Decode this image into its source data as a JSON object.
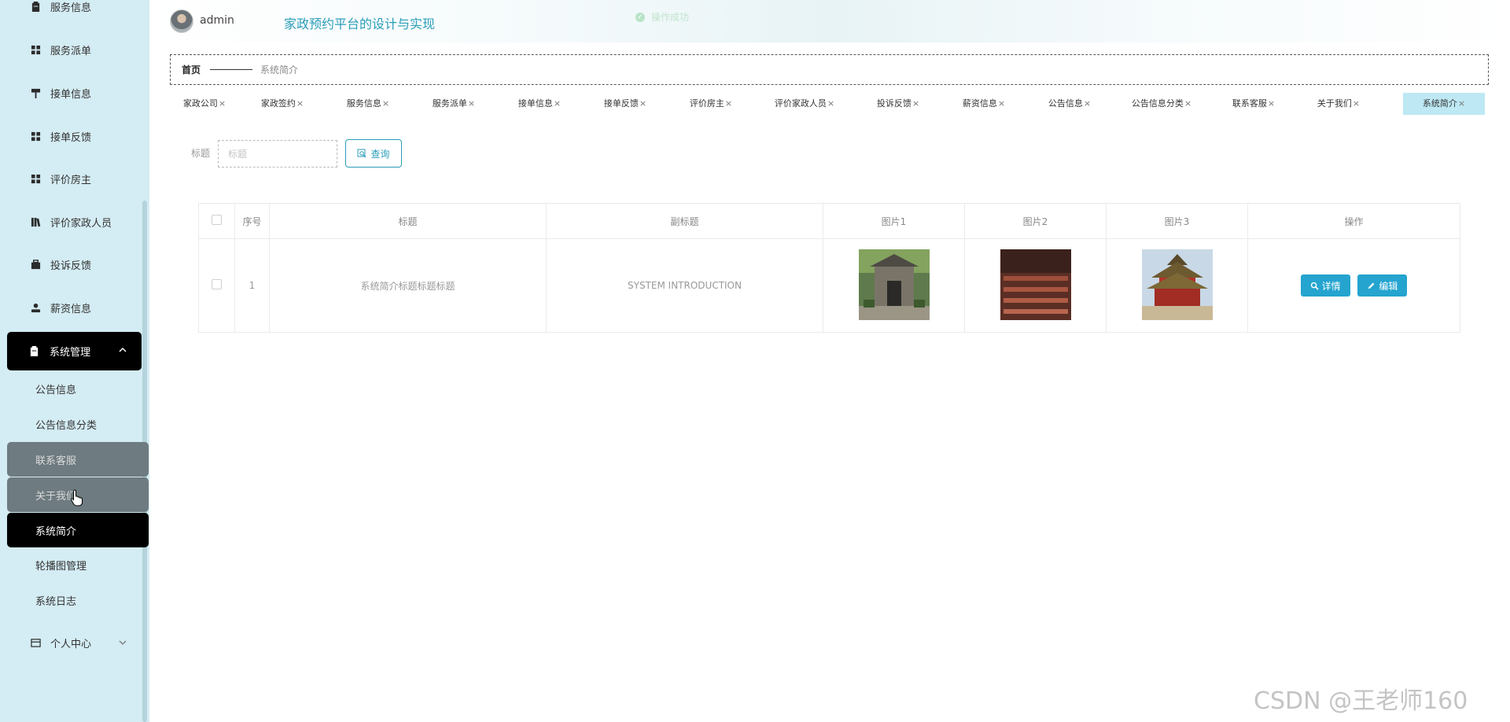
{
  "header": {
    "username": "admin",
    "app_title": "家政预约平台的设计与实现",
    "toast": "操作成功"
  },
  "sidebar": {
    "items": [
      {
        "label": "服务信息",
        "icon": "clipboard-icon"
      },
      {
        "label": "服务派单",
        "icon": "grid-icon"
      },
      {
        "label": "接单信息",
        "icon": "hammer-icon"
      },
      {
        "label": "接单反馈",
        "icon": "grid-icon"
      },
      {
        "label": "评价房主",
        "icon": "grid-icon"
      },
      {
        "label": "评价家政人员",
        "icon": "library-icon"
      },
      {
        "label": "投诉反馈",
        "icon": "briefcase-icon"
      },
      {
        "label": "薪资信息",
        "icon": "user-icon"
      }
    ],
    "group": {
      "label": "系统管理",
      "icon": "clipboard-icon"
    },
    "sub_items": [
      "公告信息",
      "公告信息分类",
      "联系客服",
      "关于我们",
      "系统简介",
      "轮播图管理",
      "系统日志"
    ],
    "personal": {
      "label": "个人中心",
      "icon": "wallet-icon"
    }
  },
  "breadcrumb": {
    "home": "首页",
    "current": "系统简介"
  },
  "tabs": [
    "家政公司",
    "家政签约",
    "服务信息",
    "服务派单",
    "接单信息",
    "接单反馈",
    "评价房主",
    "评价家政人员",
    "投诉反馈",
    "薪资信息",
    "公告信息",
    "公告信息分类",
    "联系客服",
    "关于我们",
    "系统简介"
  ],
  "tab_close": "×",
  "search": {
    "label": "标题",
    "placeholder": "标题",
    "button": "查询"
  },
  "table": {
    "headers": [
      "序号",
      "标题",
      "副标题",
      "图片1",
      "图片2",
      "图片3",
      "操作"
    ],
    "rows": [
      {
        "index": "1",
        "title": "系统简介标题标题标题",
        "subtitle": "SYSTEM INTRODUCTION"
      }
    ],
    "detail_btn": "详情",
    "edit_btn": "编辑"
  },
  "watermark": "CSDN @王老师160",
  "colors": {
    "sidebar_bg": "#d4ecf3",
    "accent": "#2a9db8",
    "button": "#24a4cf",
    "active_tab": "#bde8f4"
  }
}
